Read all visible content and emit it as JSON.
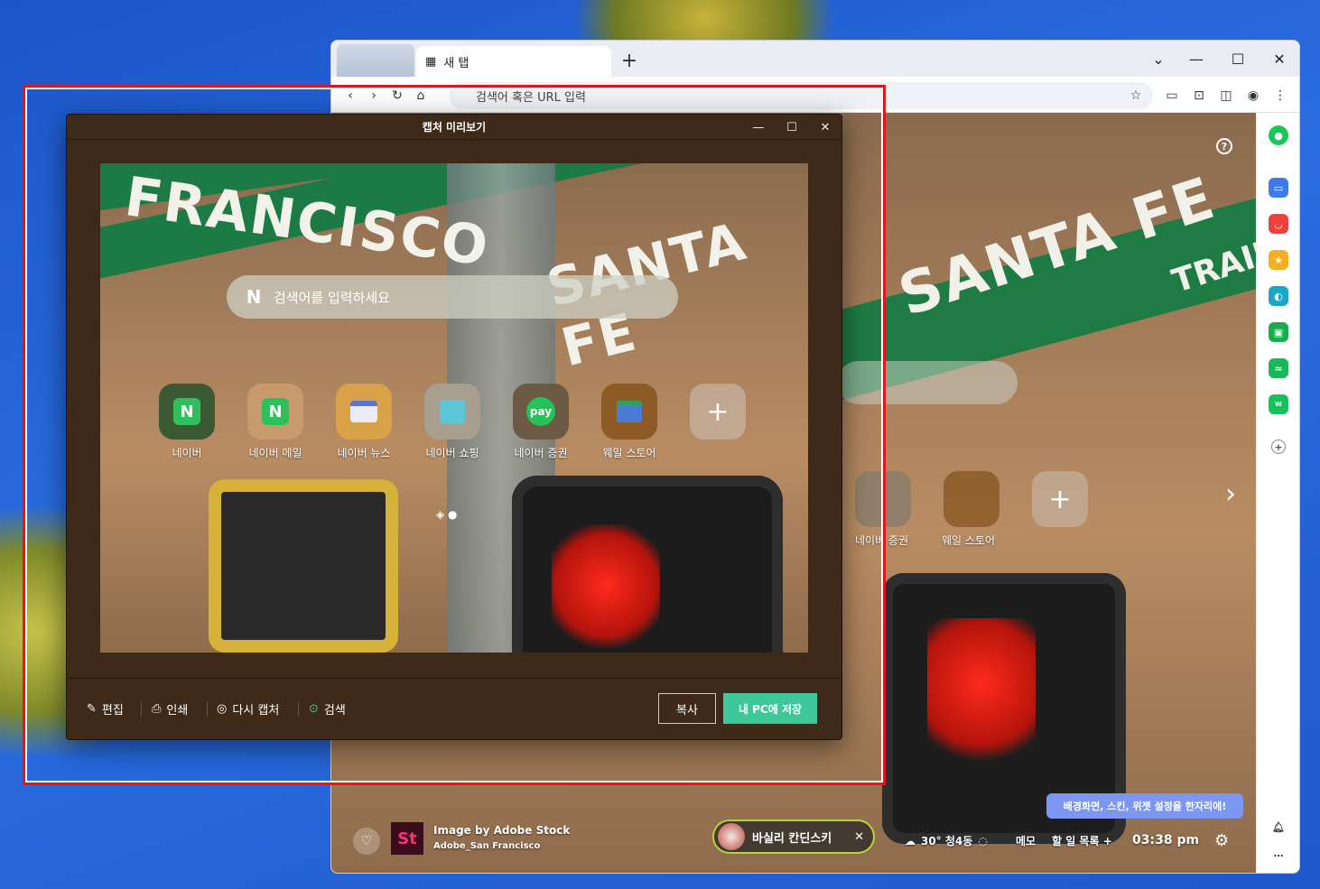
{
  "browser": {
    "tab_title": "새 탭",
    "new_tab_symbol": "+",
    "omnibox_placeholder": "검색어 혹은 URL 입력"
  },
  "newtab": {
    "help_symbol": "?",
    "bg_apps": [
      {
        "label": "네이버 증권"
      },
      {
        "label": "웨일 스토어"
      }
    ],
    "credit_line1": "Image by Adobe Stock",
    "credit_line2": "Adobe_San Francisco",
    "stock_badge": "St",
    "music_title": "바실리 칸딘스키",
    "music_close": "✕",
    "weather": "30° 청4동",
    "memo": "메모",
    "todo": "할 일 목록 +",
    "clock": "03:38 pm",
    "tooltip": "배경화면, 스킨, 위젯 설정을 한자리에!",
    "sign_main": "SANTA FE",
    "sign_trail": "TRAIL"
  },
  "capture_window": {
    "title": "캡처 미리보기",
    "preview": {
      "search_placeholder": "검색어를 입력하세요",
      "sign_left": "FRANCISCO",
      "sign_right": "SANTA FE",
      "apps": [
        {
          "label": "네이버",
          "icon": "naver-icon"
        },
        {
          "label": "네이버 메일",
          "icon": "naver-mail-icon"
        },
        {
          "label": "네이버 뉴스",
          "icon": "naver-news-icon"
        },
        {
          "label": "네이버 쇼핑",
          "icon": "naver-shopping-icon"
        },
        {
          "label": "네이버 증권",
          "icon": "pay-icon"
        },
        {
          "label": "웨일 스토어",
          "icon": "whale-store-icon"
        },
        {
          "label": "",
          "icon": "add-icon"
        }
      ]
    },
    "footer": {
      "edit": "편집",
      "print": "인쇄",
      "recapture": "다시 캡처",
      "search": "검색",
      "copy": "복사",
      "save": "내 PC에 저장"
    }
  },
  "colors": {
    "save_button": "#3ec79a",
    "highlight_frame": "#e8141a",
    "naver_green": "#2fc05e",
    "tooltip_bg": "#7d96f0"
  }
}
